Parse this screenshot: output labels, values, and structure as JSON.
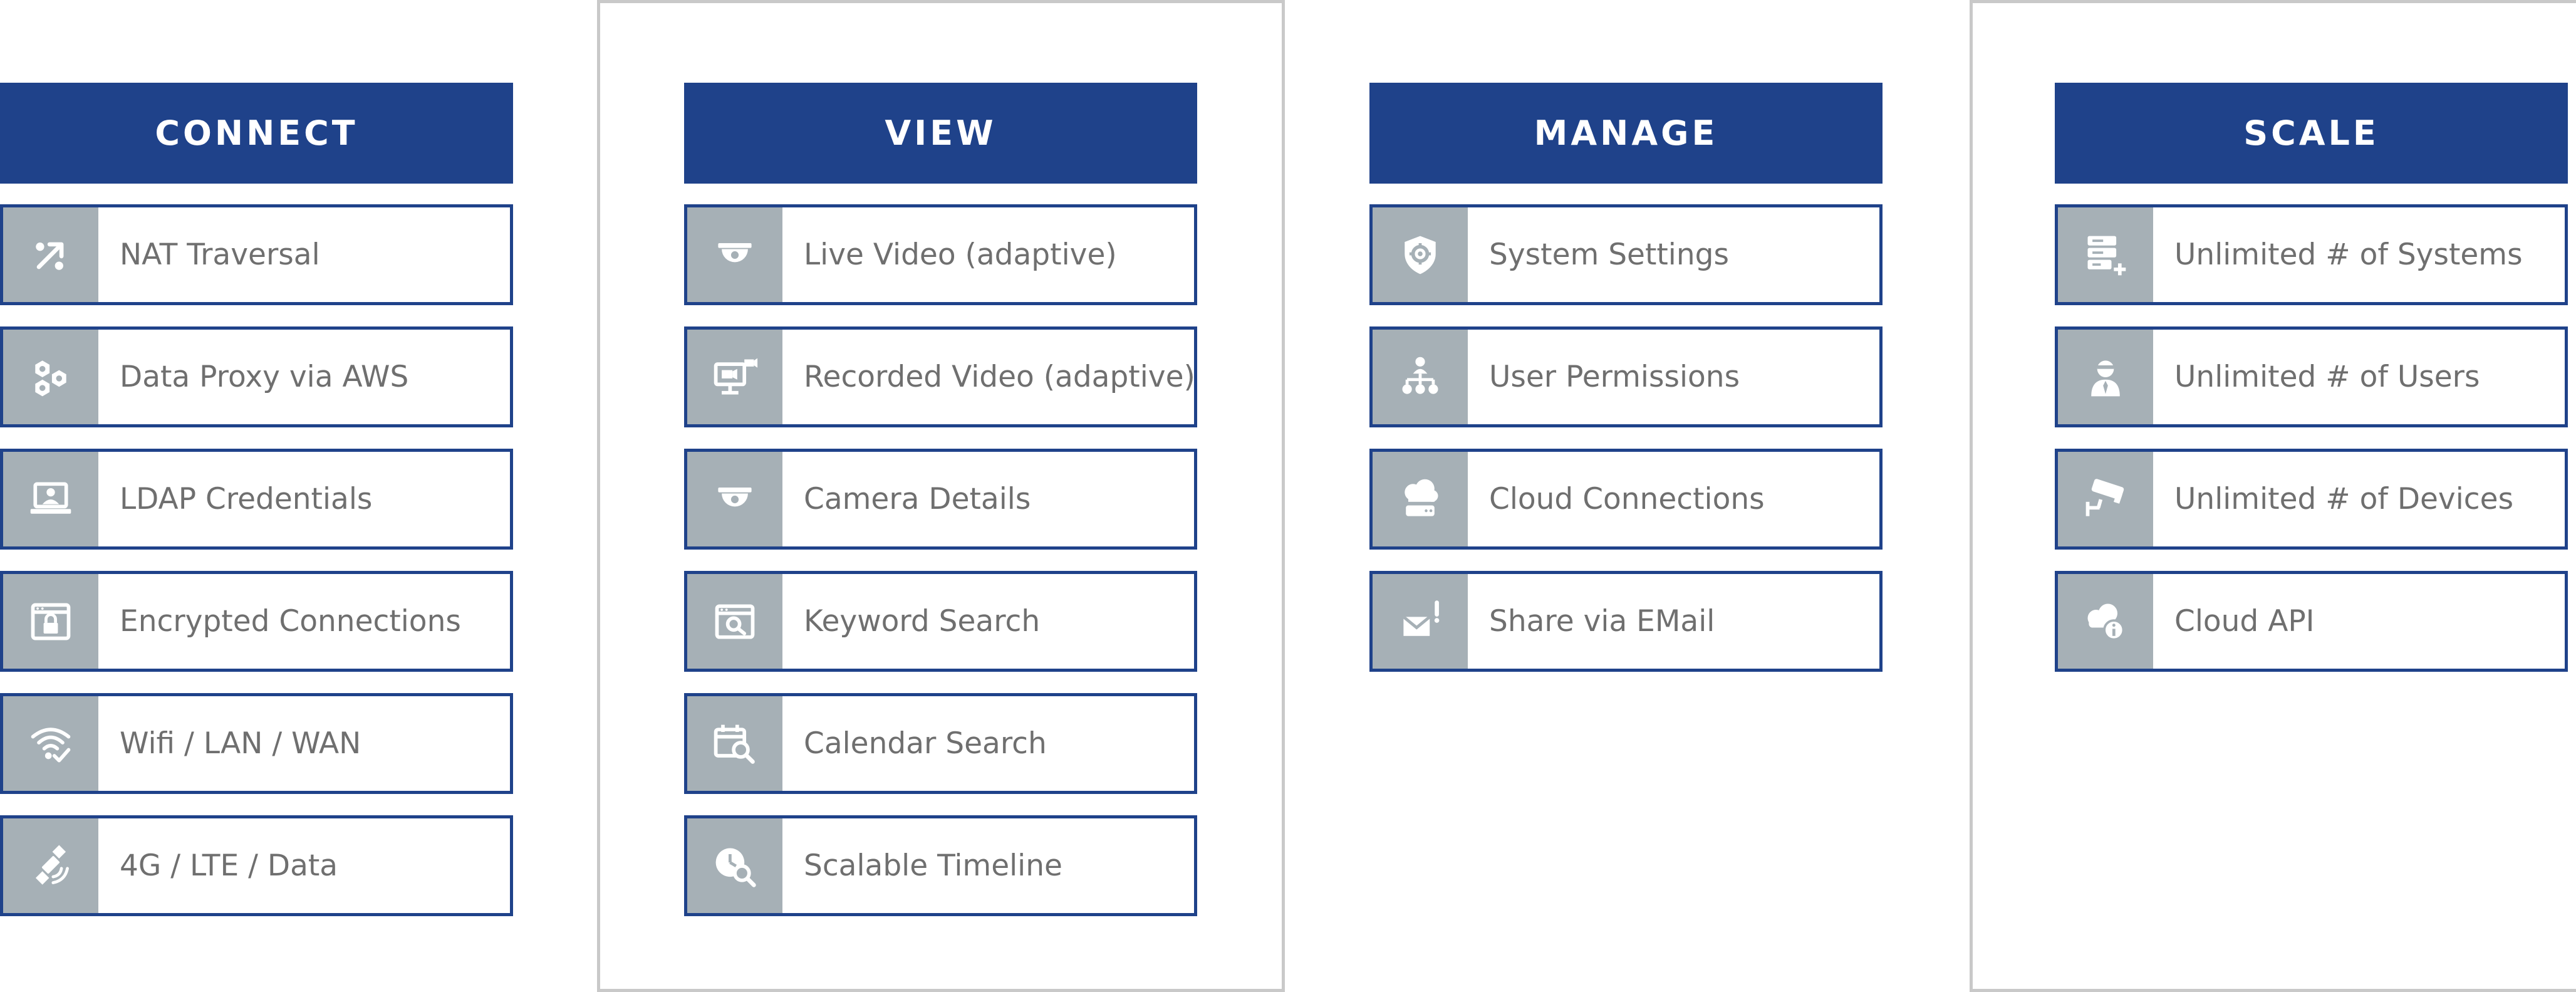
{
  "columns": [
    {
      "title": "CONNECT",
      "items": [
        {
          "label": "NAT Traversal",
          "icon": "nat-traversal-icon"
        },
        {
          "label": "Data Proxy via AWS",
          "icon": "data-proxy-icon"
        },
        {
          "label": "LDAP Credentials",
          "icon": "ldap-credentials-icon"
        },
        {
          "label": "Encrypted Connections",
          "icon": "encrypted-lock-icon"
        },
        {
          "label": "Wifi / LAN / WAN",
          "icon": "wifi-icon"
        },
        {
          "label": "4G / LTE / Data",
          "icon": "satellite-icon"
        }
      ]
    },
    {
      "title": "VIEW",
      "items": [
        {
          "label": "Live Video (adaptive)",
          "icon": "dome-camera-icon"
        },
        {
          "label": "Recorded Video (adaptive)",
          "icon": "recorded-video-icon"
        },
        {
          "label": "Camera Details",
          "icon": "camera-details-icon"
        },
        {
          "label": "Keyword Search",
          "icon": "keyword-search-icon"
        },
        {
          "label": "Calendar Search",
          "icon": "calendar-search-icon"
        },
        {
          "label": "Scalable Timeline",
          "icon": "timeline-icon"
        }
      ]
    },
    {
      "title": "MANAGE",
      "items": [
        {
          "label": "System Settings",
          "icon": "shield-gear-icon"
        },
        {
          "label": "User Permissions",
          "icon": "org-chart-icon"
        },
        {
          "label": "Cloud Connections",
          "icon": "cloud-server-icon"
        },
        {
          "label": "Share via EMail",
          "icon": "email-alert-icon"
        }
      ]
    },
    {
      "title": "SCALE",
      "items": [
        {
          "label": "Unlimited # of Systems",
          "icon": "server-add-icon"
        },
        {
          "label": "Unlimited # of Users",
          "icon": "user-icon"
        },
        {
          "label": "Unlimited # of Devices",
          "icon": "cctv-camera-icon"
        },
        {
          "label": "Cloud API",
          "icon": "cloud-info-icon"
        }
      ]
    }
  ],
  "colors": {
    "header_bg": "#1f428a",
    "item_border": "#1f428a",
    "icon_cell_bg": "#a6b0b6",
    "label_text": "#6f6f6f",
    "column_border": "#c9c9c9"
  }
}
